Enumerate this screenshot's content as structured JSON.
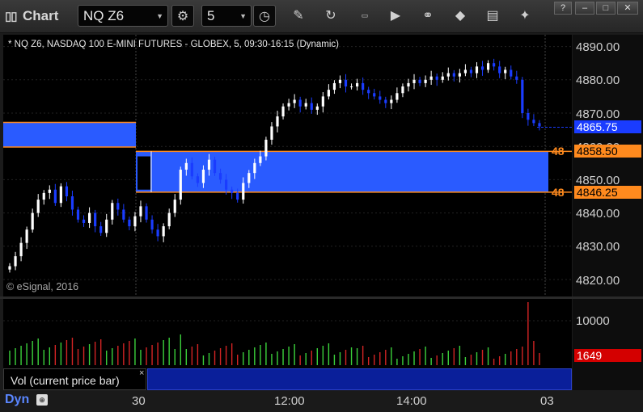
{
  "window": {
    "title": "Chart",
    "buttons": [
      "minimize",
      "maximize",
      "close"
    ]
  },
  "toolbar": {
    "symbol": "NQ Z6",
    "interval": "5",
    "icons": [
      "settings-gear-icon",
      "clock-icon",
      "pencil-icon",
      "refresh-icon",
      "get-icon",
      "play-icon",
      "link-icon",
      "comment-icon",
      "twitter-icon"
    ]
  },
  "chart": {
    "info": "* NQ Z6, NASDAQ 100 E-MINI FUTURES - GLOBEX, 5, 09:30-16:15 (Dynamic)",
    "copyright": "© eSignal, 2016",
    "price_axis": [
      "4890.00",
      "4880.00",
      "4870.00",
      "4860.00",
      "4850.00",
      "4840.00",
      "4830.00",
      "4820.00"
    ],
    "last_price": "4865.75",
    "zone_top_label": "4858.50",
    "zone_bottom_label": "4846.25",
    "zone_left_marker": "48",
    "colors": {
      "up_candle": "#ffffff",
      "down_candle": "#1a3cff",
      "zone_fill": "#2a5bff",
      "zone_border": "#ff8a1e",
      "last_price_tag": "#1a3cff",
      "volume_tag": "#d40000"
    }
  },
  "volume": {
    "legend": "Vol (current price bar)",
    "axis_label": "10000",
    "last_volume": "1649"
  },
  "time_axis": {
    "labels": [
      "30",
      "12:00",
      "14:00",
      "03"
    ],
    "mode": "Dyn"
  }
}
